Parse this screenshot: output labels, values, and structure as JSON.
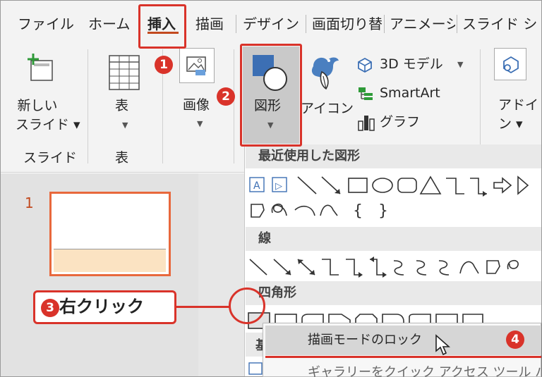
{
  "tabs": [
    "ファイル",
    "ホーム",
    "挿入",
    "描画",
    "デザイン",
    "画面切り替",
    "アニメーシ",
    "スライド シ"
  ],
  "ribbon": {
    "new_slide_line1": "新しい",
    "new_slide_line2": "スライド ▾",
    "table": "表",
    "image": "画像",
    "shapes": "図形",
    "icons": "アイコン",
    "model3d": "3D モデル",
    "smartart": "SmartArt",
    "chart": "グラフ",
    "addin_line1": "アドイ",
    "addin_line2": "ン ▾",
    "group_slides": "スライド",
    "group_table": "表"
  },
  "slide_panel": {
    "slide_number": "1"
  },
  "gallery": {
    "recent": "最近使用した図形",
    "lines": "線",
    "rectangles": "四角形",
    "next_section_fragment": "基"
  },
  "context_menu": {
    "item1": "描画モードのロック",
    "item2": "ギャラリーをクイック アクセス ツール バ"
  },
  "annotations": {
    "badge1": "1",
    "badge2": "2",
    "badge3": "3",
    "badge4": "4",
    "callout_text": "右クリック"
  },
  "colors": {
    "accent_red": "#d9332a",
    "slide_border": "#e8683c",
    "slide_footer": "#fbe3c2",
    "shape_blue": "#3c6fb4"
  }
}
